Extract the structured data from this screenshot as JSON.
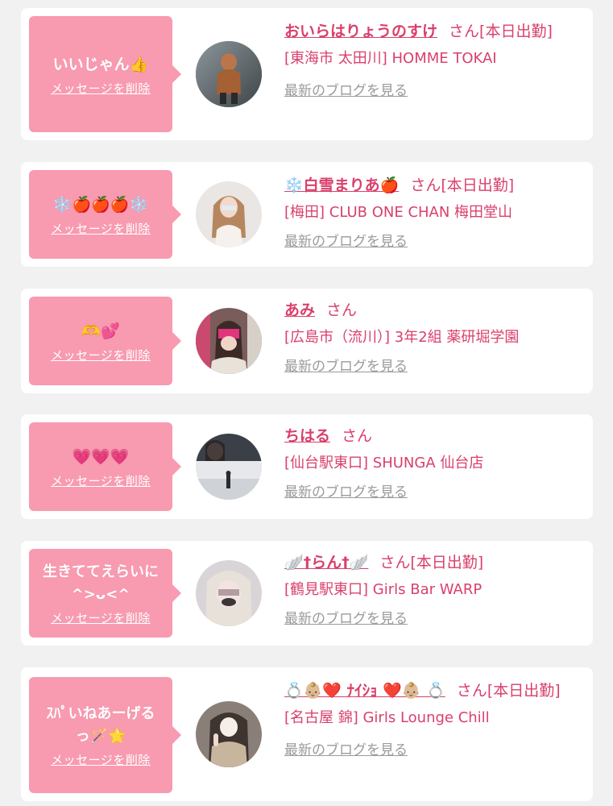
{
  "colors": {
    "accent": "#d9406c",
    "bubble": "#f89ab0",
    "card": "#ffffff",
    "background": "#f1f1f1",
    "link_gray": "#9a9a9a"
  },
  "common": {
    "delete_label": "メッセージを削除",
    "san": "さん",
    "blog_label": "最新のブログを見る"
  },
  "items": [
    {
      "message": "いいじゃん👍",
      "name": "おいらはりょうのすけ",
      "status": "[本日出勤]",
      "shop": "[東海市 太田川] HOMME TOKAI",
      "avatar_icon": "person-in-hoodie-photo"
    },
    {
      "message": "❄️🍎🍎🍎❄️",
      "name": "❄️白雪まりあ🍎",
      "status": "[本日出勤]",
      "shop": "[梅田] CLUB ONE CHAN 梅田堂山",
      "avatar_icon": "woman-portrait-photo"
    },
    {
      "message": "🫶💕",
      "name": "あみ",
      "status": "",
      "shop": "[広島市（流川）] 3年2組 薬研堀学園",
      "avatar_icon": "school-uniform-photo"
    },
    {
      "message": "💗💗💗",
      "name": "ちはる",
      "status": "",
      "shop": "[仙台駅東口] SHUNGA 仙台店",
      "avatar_icon": "snow-scene-photo"
    },
    {
      "message": "生きててえらいに^>ᴗ<^",
      "name": "🪽†らん†🪽",
      "status": "[本日出勤]",
      "shop": "[鶴見駅東口] Girls Bar WARP",
      "avatar_icon": "blonde-selfie-photo"
    },
    {
      "message": "ｽﾊﾟいねあーげるっ🪄🌟",
      "name": "💍👶🏼❤️ ﾅｲｼｮ ❤️👶🏼 💍",
      "status": "[本日出勤]",
      "shop": "[名古屋 錦] Girls Lounge Chill",
      "avatar_icon": "pose-selfie-photo"
    }
  ]
}
